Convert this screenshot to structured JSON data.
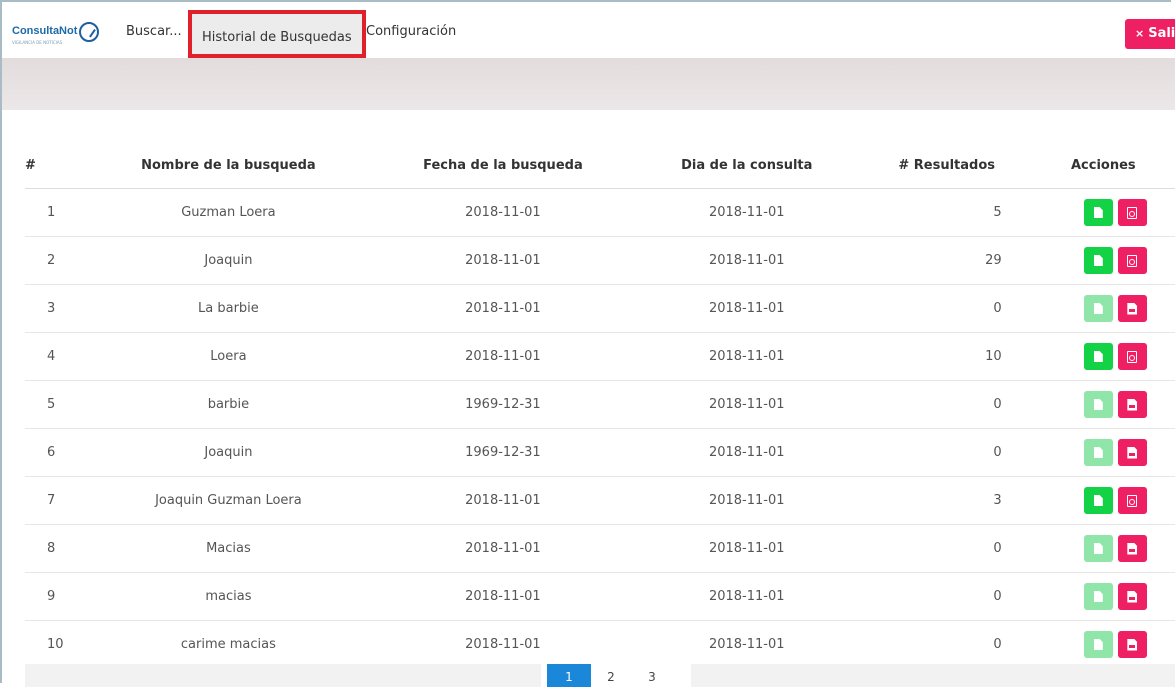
{
  "app": {
    "logo_text_main": "ConsultaNot",
    "logo_subtext": "VIGILANCIA DE NOTICIAS",
    "accent": "#ef1f63",
    "highlight_border": "#e0202a"
  },
  "nav": {
    "buscar": "Buscar...",
    "historial": "Historial de Busquedas",
    "config": "Configuración",
    "salir": "Sali",
    "salir_icon": "×"
  },
  "table": {
    "headers": {
      "num": "#",
      "name": "Nombre de la busqueda",
      "date": "Fecha de la busqueda",
      "day": "Dia de la consulta",
      "results": "# Resultados",
      "actions": "Acciones"
    },
    "rows": [
      {
        "num": "1",
        "name": "Guzman Loera",
        "date": "2018-11-01",
        "day": "2018-11-01",
        "results": "5",
        "enabled": true
      },
      {
        "num": "2",
        "name": "Joaquin",
        "date": "2018-11-01",
        "day": "2018-11-01",
        "results": "29",
        "enabled": true
      },
      {
        "num": "3",
        "name": "La barbie",
        "date": "2018-11-01",
        "day": "2018-11-01",
        "results": "0",
        "enabled": false
      },
      {
        "num": "4",
        "name": "Loera",
        "date": "2018-11-01",
        "day": "2018-11-01",
        "results": "10",
        "enabled": true
      },
      {
        "num": "5",
        "name": "barbie",
        "date": "1969-12-31",
        "day": "2018-11-01",
        "results": "0",
        "enabled": false
      },
      {
        "num": "6",
        "name": "Joaquin",
        "date": "1969-12-31",
        "day": "2018-11-01",
        "results": "0",
        "enabled": false
      },
      {
        "num": "7",
        "name": "Joaquin Guzman Loera",
        "date": "2018-11-01",
        "day": "2018-11-01",
        "results": "3",
        "enabled": true
      },
      {
        "num": "8",
        "name": "Macias",
        "date": "2018-11-01",
        "day": "2018-11-01",
        "results": "0",
        "enabled": false
      },
      {
        "num": "9",
        "name": "macias",
        "date": "2018-11-01",
        "day": "2018-11-01",
        "results": "0",
        "enabled": false
      },
      {
        "num": "10",
        "name": "carime macias",
        "date": "2018-11-01",
        "day": "2018-11-01",
        "results": "0",
        "enabled": false
      }
    ]
  },
  "pagination": {
    "pages": [
      "1",
      "2",
      "3"
    ],
    "active": "1"
  }
}
